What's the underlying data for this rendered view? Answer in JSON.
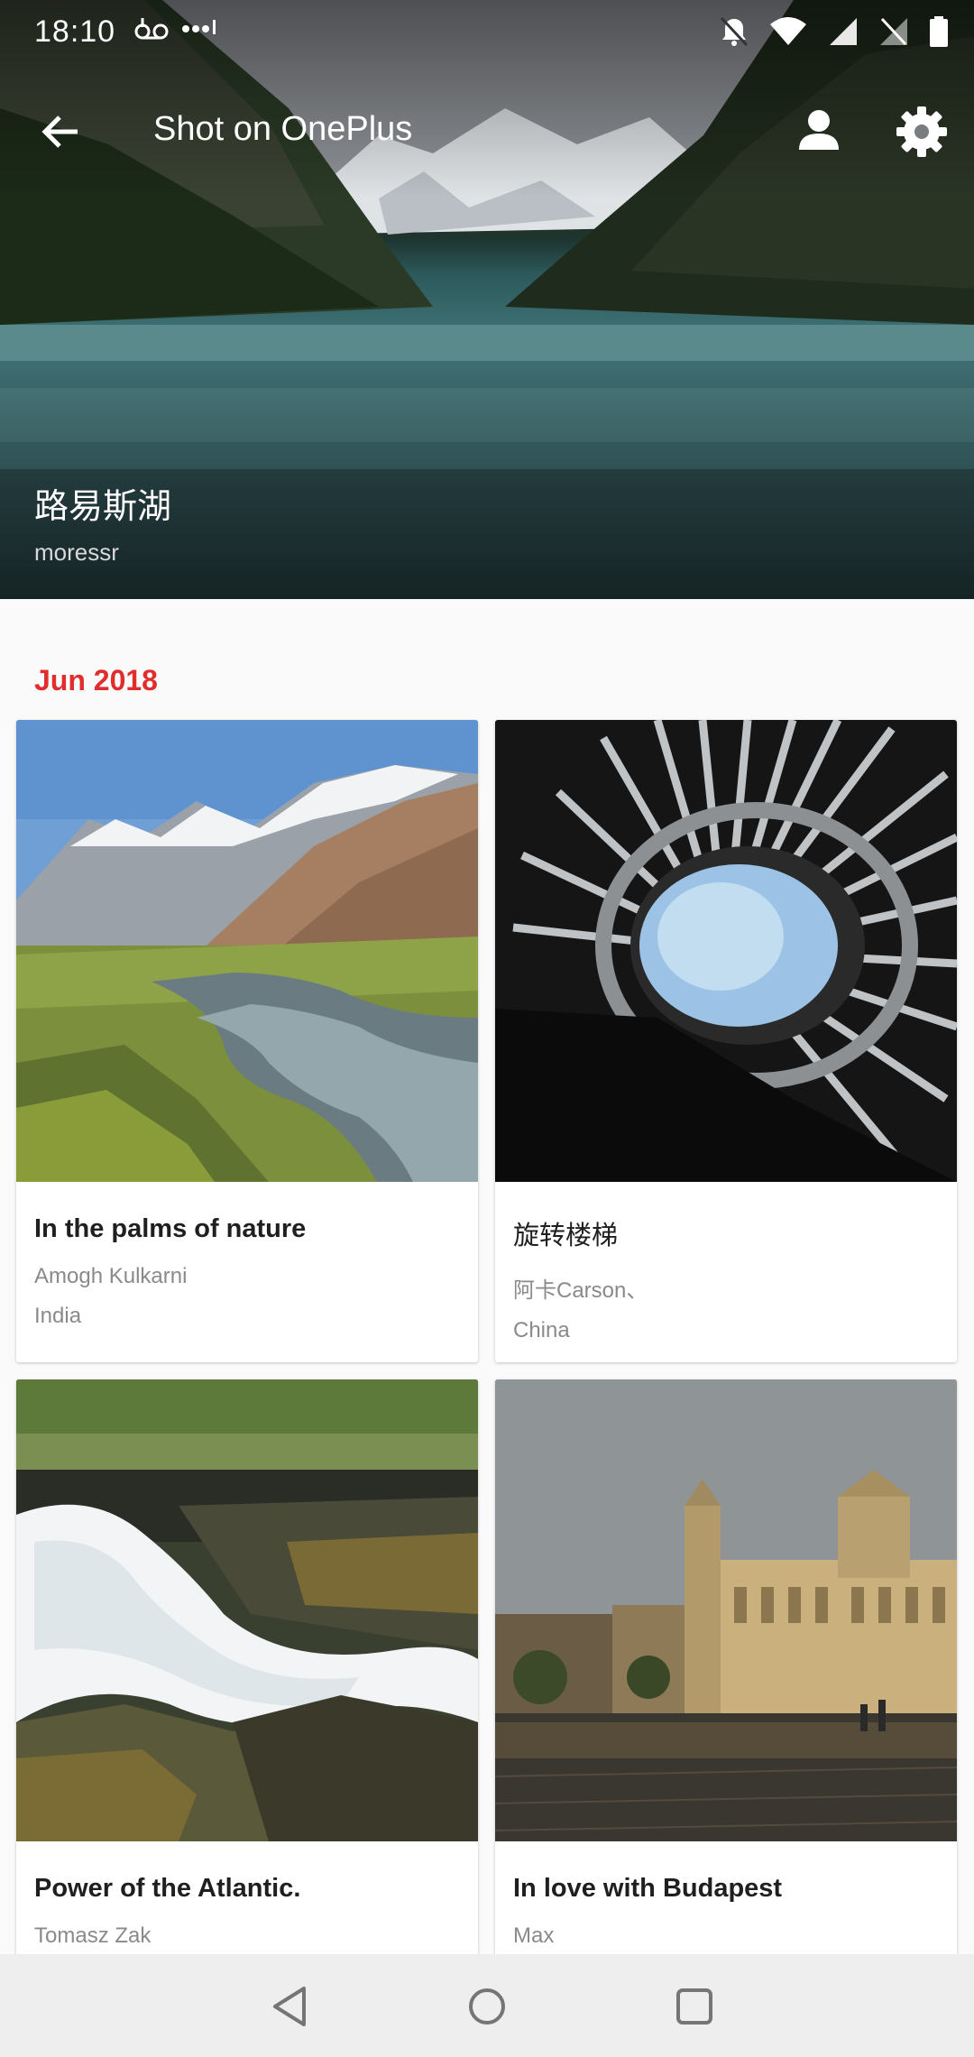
{
  "status_bar": {
    "time": "18:10",
    "voicemail_icon": "voicemail-icon",
    "more_icon": "more-dots-icon"
  },
  "app_bar": {
    "title": "Shot on OnePlus",
    "back_icon": "arrow-back-icon",
    "account_icon": "account-icon",
    "settings_icon": "gear-icon"
  },
  "hero": {
    "title": "路易斯湖",
    "author": "moressr"
  },
  "section": {
    "label": "Jun 2018"
  },
  "cards": [
    {
      "title": "In the palms of nature",
      "author": "Amogh Kulkarni",
      "place": "India"
    },
    {
      "title": "旋转楼梯",
      "author": "阿卡Carson、",
      "place": "China"
    },
    {
      "title": "Power of the Atlantic.",
      "author": "Tomasz Zak",
      "place": ""
    },
    {
      "title": "In love with Budapest",
      "author": "Max",
      "place": ""
    }
  ],
  "navigation": {
    "back_icon": "nav-back-icon",
    "home_icon": "nav-home-icon",
    "recents_icon": "nav-recents-icon"
  },
  "colors": {
    "accent": "#e02e2e",
    "background": "#fafafa",
    "navbar": "#eeeeee"
  }
}
